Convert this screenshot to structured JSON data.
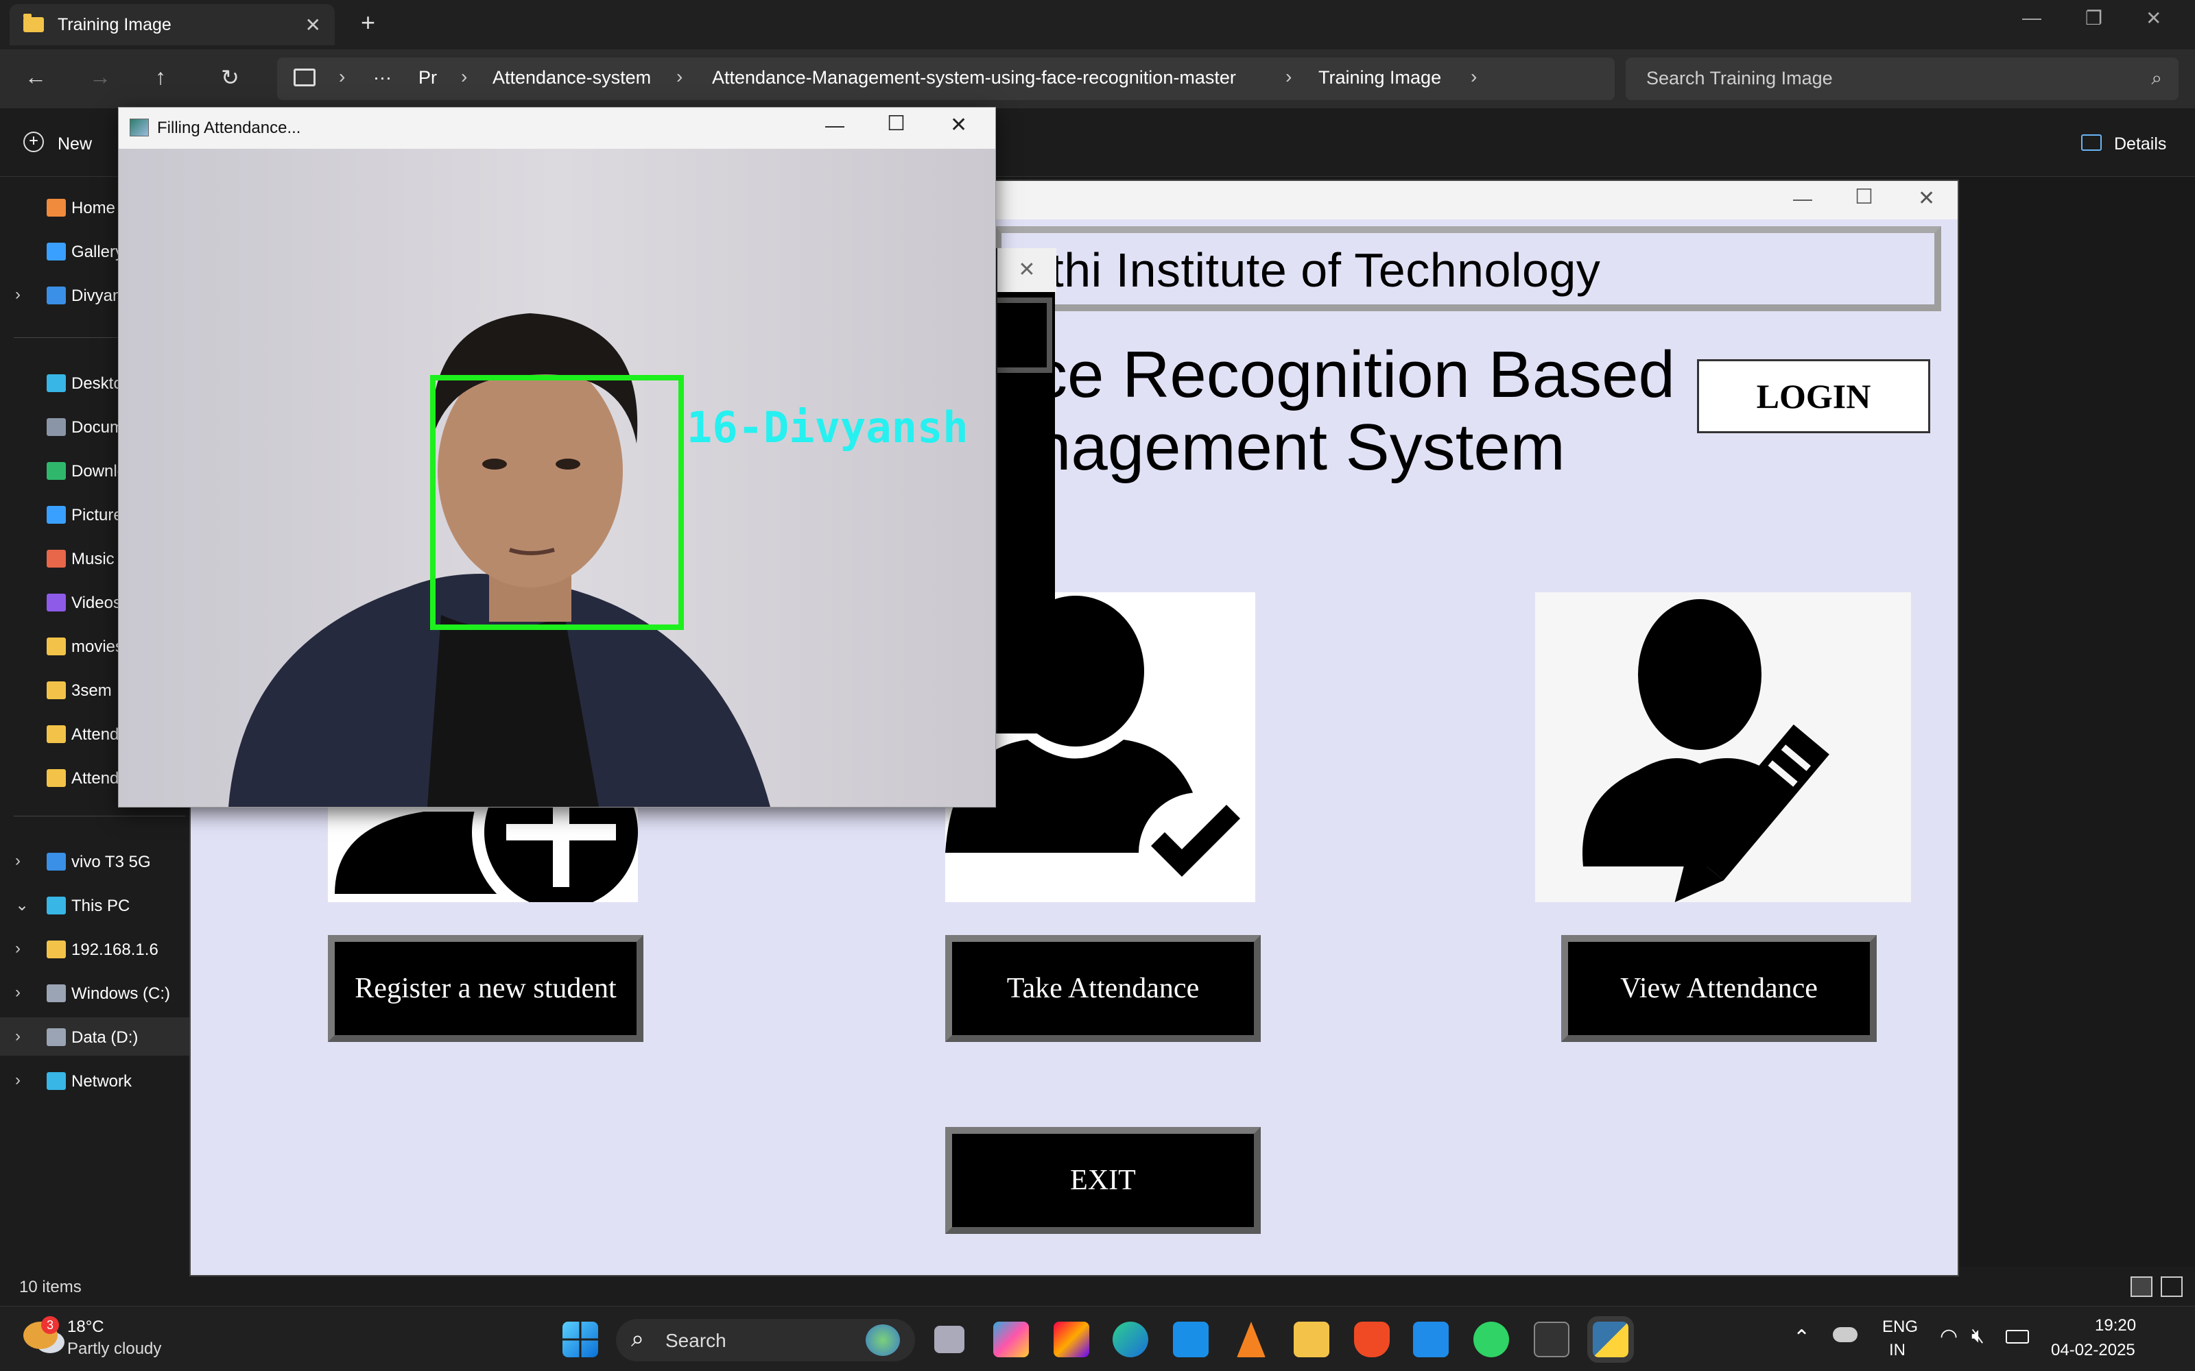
{
  "explorer": {
    "tab_title": "Training Image",
    "breadcrumb": [
      "Pr",
      "Attendance-system",
      "Attendance-Management-system-using-face-recognition-master",
      "Training Image"
    ],
    "search_placeholder": "Search Training Image",
    "new_label": "New",
    "details_label": "Details",
    "sidebar": [
      {
        "label": "Home",
        "color": "#f08a3c",
        "chevron": ""
      },
      {
        "label": "Gallery",
        "color": "#3aa0ff",
        "chevron": ""
      },
      {
        "label": "Divyansh - Personal",
        "color": "#3a8fe6",
        "chevron": "›"
      },
      {
        "label": "Desktop",
        "color": "#38b6e6",
        "chevron": ""
      },
      {
        "label": "Documents",
        "color": "#8a96a8",
        "chevron": ""
      },
      {
        "label": "Downloads",
        "color": "#2fb86c",
        "chevron": ""
      },
      {
        "label": "Pictures",
        "color": "#3aa0ff",
        "chevron": ""
      },
      {
        "label": "Music",
        "color": "#e8664a",
        "chevron": ""
      },
      {
        "label": "Videos",
        "color": "#8e5be8",
        "chevron": ""
      },
      {
        "label": "movies",
        "color": "#f2c348",
        "chevron": ""
      },
      {
        "label": "3sem",
        "color": "#f2c348",
        "chevron": ""
      },
      {
        "label": "Attendance-system",
        "color": "#f2c348",
        "chevron": ""
      },
      {
        "label": "Attendance-Management",
        "color": "#f2c348",
        "chevron": ""
      }
    ],
    "sidebar_lower": [
      {
        "label": "vivo T3 5G",
        "color": "#3a8fe6",
        "chevron": "›"
      },
      {
        "label": "This PC",
        "color": "#38b6e6",
        "chevron": "⌄"
      },
      {
        "label": "192.168.1.6",
        "color": "#f2c348",
        "chevron": "›"
      },
      {
        "label": "Windows (C:)",
        "color": "#9aa4b4",
        "chevron": "›"
      },
      {
        "label": "Data (D:)",
        "color": "#9aa4b4",
        "chevron": "›"
      },
      {
        "label": "Network",
        "color": "#38b6e6",
        "chevron": "›"
      }
    ],
    "status_items": "10 items"
  },
  "tk": {
    "institute": "rathi Institute of Technology",
    "heading_line1": "ce Recognition Based",
    "heading_line2": "nagement System",
    "login_label": "LOGIN",
    "register_label": "Register a new student",
    "take_label": "Take Attendance",
    "view_label": "View Attendance",
    "exit_label": "EXIT"
  },
  "cam": {
    "title": "Filling Attendance...",
    "face_label": "16-Divyansh"
  },
  "taskbar": {
    "weather_temp": "18°C",
    "weather_desc": "Partly cloudy",
    "weather_badge": "3",
    "search_label": "Search",
    "lang1": "ENG",
    "lang2": "IN",
    "time": "19:20",
    "date": "04-02-2025"
  },
  "colors": {
    "accent_green": "#1df01d",
    "accent_cyan": "#27f0f0",
    "tk_bg": "#e1e1f6"
  }
}
